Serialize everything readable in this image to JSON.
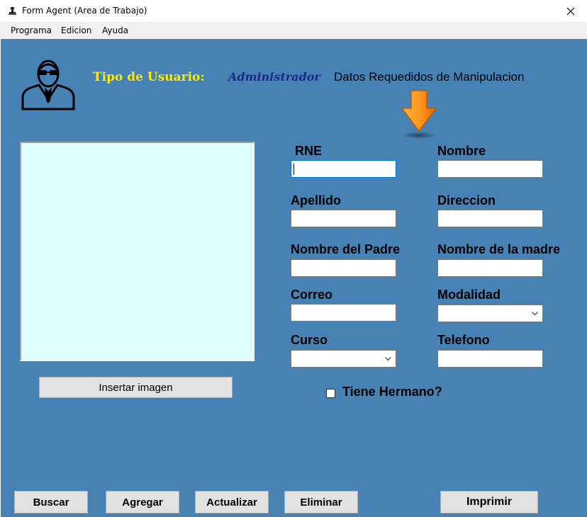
{
  "window": {
    "title": "Form Agent (Area de Trabajo)"
  },
  "menu": [
    "Programa",
    "Edicion",
    "Ayuda"
  ],
  "header": {
    "user_type_label": "Tipo de Usuario:",
    "user_type_value": "Administrador",
    "required_data_label": "Datos Requedidos de Manipulacion"
  },
  "image_panel": {
    "insert_button": "Insertar imagen"
  },
  "fields": {
    "rne": {
      "label": "RNE",
      "value": ""
    },
    "nombre": {
      "label": "Nombre",
      "value": ""
    },
    "apellido": {
      "label": "Apellido",
      "value": ""
    },
    "direccion": {
      "label": "Direccion",
      "value": ""
    },
    "nombre_padre": {
      "label": "Nombre del Padre",
      "value": ""
    },
    "nombre_madre": {
      "label": "Nombre de la madre",
      "value": ""
    },
    "correo": {
      "label": "Correo",
      "value": ""
    },
    "modalidad": {
      "label": "Modalidad",
      "value": ""
    },
    "curso": {
      "label": "Curso",
      "value": ""
    },
    "telefono": {
      "label": "Telefono",
      "value": ""
    }
  },
  "tiene_hermano": {
    "label": "Tiene Hermano?",
    "checked": false
  },
  "buttons": {
    "buscar": "Buscar",
    "agregar": "Agregar",
    "actualizar": "Actualizar",
    "eliminar": "Eliminar",
    "imprimir": "Imprimir"
  },
  "colors": {
    "background": "#4682b4",
    "user_type_label": "#ffea00",
    "user_type_value": "#1d2a8a",
    "picture_box": "#e0ffff",
    "arrow": "#ff8c00"
  }
}
